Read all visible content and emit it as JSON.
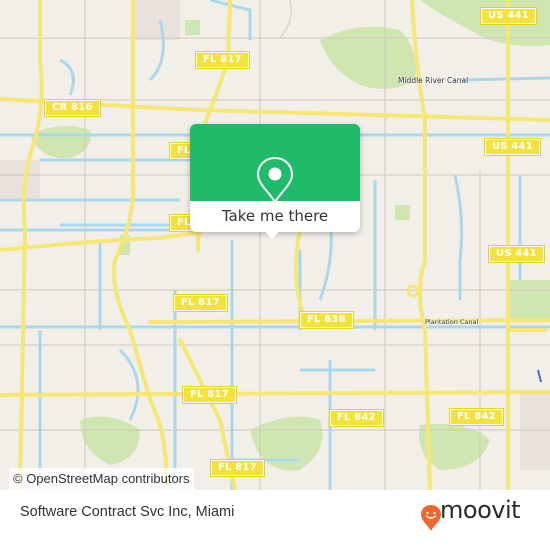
{
  "map": {
    "road_shields": [
      {
        "label": "US 441"
      },
      {
        "label": "FL 817"
      },
      {
        "label": "CR 816"
      },
      {
        "label": "FL 817"
      },
      {
        "label": "US 441"
      },
      {
        "label": "FL 817"
      },
      {
        "label": "US 441"
      },
      {
        "label": "FL 817"
      },
      {
        "label": "FL 838"
      },
      {
        "label": "FL 817"
      },
      {
        "label": "FL 842"
      },
      {
        "label": "FL 842"
      },
      {
        "label": "FL 817"
      }
    ],
    "place_labels": [
      {
        "label": "Middle River Canal"
      },
      {
        "label": "Plantation Canal"
      }
    ],
    "attribution": "© OpenStreetMap contributors",
    "colors": {
      "land": "#f2efe9",
      "water": "#a9d8ee",
      "park": "#cfe6b0",
      "major_road": "#f6e775",
      "minor_road": "#cfc8bd"
    }
  },
  "popup": {
    "icon": "map-pin-icon",
    "action_label": "Take me there",
    "accent_color": "#1fbb6a"
  },
  "footer": {
    "place_name": "Software Contract Svc Inc, Miami",
    "brand": {
      "name": "moovit",
      "icon": "moovit-pin-smile-icon",
      "color": "#f0662e"
    }
  }
}
